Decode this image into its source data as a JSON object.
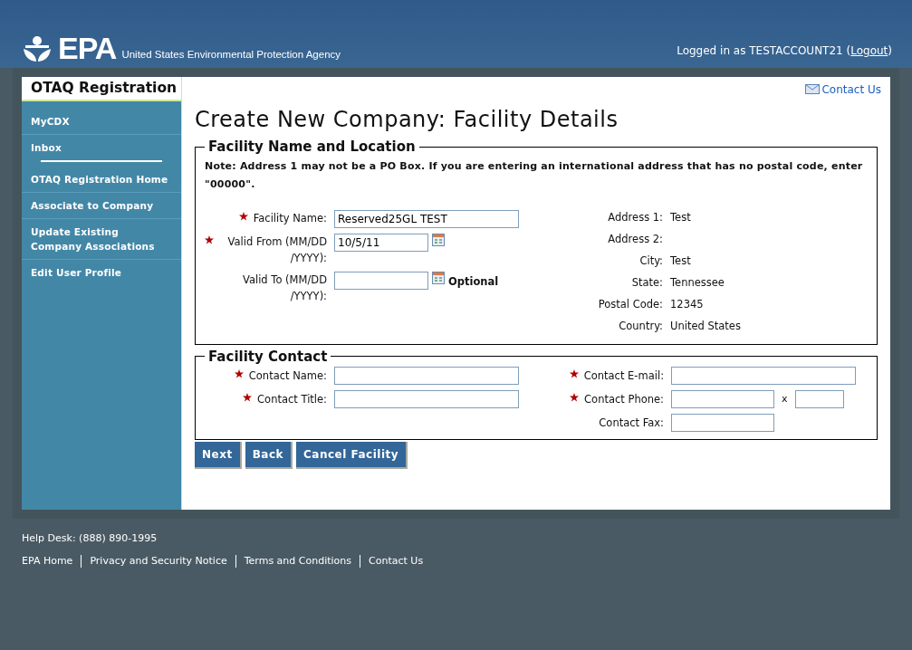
{
  "header": {
    "logo": "EPA",
    "agency": "United States Environmental Protection Agency",
    "login_text": "Logged in as TESTACCOUNT21 (",
    "logout": "Logout",
    "login_end": ")"
  },
  "sidebar": {
    "title": "OTAQ Registration",
    "sections": [
      {
        "items": [
          {
            "label": "MyCDX"
          },
          {
            "label": "Inbox"
          }
        ]
      },
      {
        "items": [
          {
            "label": "OTAQ Registration Home"
          },
          {
            "label": "Associate to Company"
          },
          {
            "label": "Update Existing Company Associations"
          },
          {
            "label": "Edit User Profile"
          }
        ]
      }
    ]
  },
  "contact_link": "Contact Us",
  "page_title": "Create New Company: Facility Details",
  "location": {
    "legend": "Facility Name and Location",
    "note": "Note: Address 1 may not be a PO Box. If you are entering an international address that has no postal code, enter \"00000\".",
    "fields": [
      {
        "label": "Facility Name:",
        "required": true,
        "kind": "text",
        "value": "Reserved25GL TEST"
      },
      {
        "label": "Valid From (MM/DD /YYYY):",
        "required": true,
        "kind": "date",
        "value": "10/5/11"
      },
      {
        "label": "Valid To (MM/DD /YYYY):",
        "required": false,
        "kind": "date",
        "hint": "Optional"
      }
    ],
    "address": [
      {
        "label": "Address 1:",
        "value": "Test"
      },
      {
        "label": "Address 2:"
      },
      {
        "label": "City:",
        "value": "Test"
      },
      {
        "label": "State:",
        "value": "Tennessee"
      },
      {
        "label": "Postal Code:",
        "value": "12345"
      },
      {
        "label": "Country:",
        "value": "United States"
      }
    ]
  },
  "contact": {
    "legend": "Facility Contact",
    "left": [
      {
        "label": "Contact Name:",
        "required": true,
        "kind": "text"
      },
      {
        "label": "Contact Title:",
        "required": true,
        "kind": "text"
      }
    ],
    "right": [
      {
        "label": "Contact E-mail:",
        "required": true,
        "kind": "text"
      },
      {
        "label": "Contact Phone:",
        "required": true,
        "kind": "phone",
        "ext_label": "x"
      },
      {
        "label": "Contact Fax:",
        "required": false,
        "kind": "short"
      }
    ]
  },
  "buttons": [
    "Next",
    "Back",
    "Cancel Facility"
  ],
  "footer": {
    "help_desk": "Help Desk: (888) 890-1995",
    "links": [
      "EPA Home",
      "Privacy and Security Notice",
      "Terms and Conditions",
      "Contact Us"
    ]
  }
}
